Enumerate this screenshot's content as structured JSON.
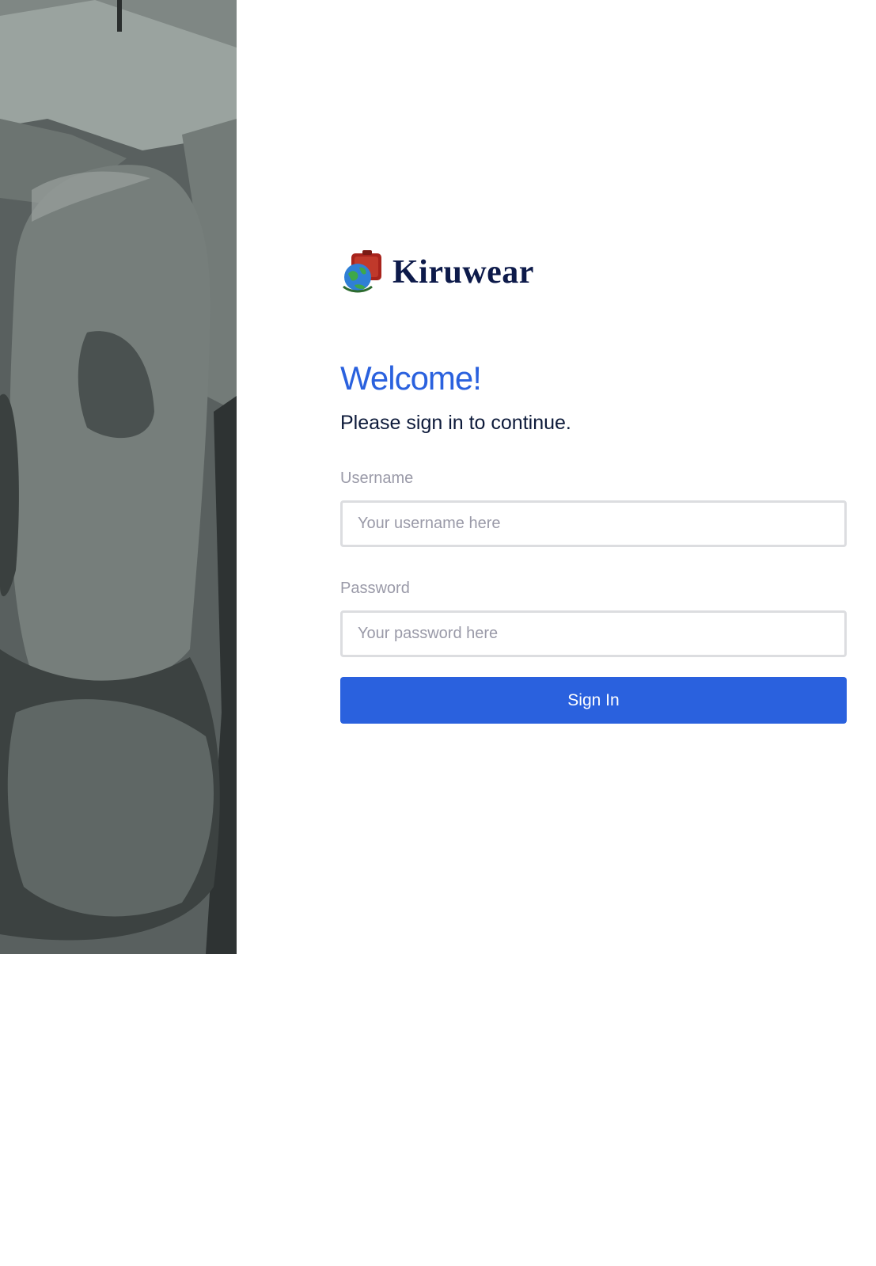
{
  "brand": {
    "name": "Kiruwear",
    "logo_icon": "globe-luggage-logo"
  },
  "side_image": {
    "description_icon": "stone-sculpture-photo"
  },
  "login": {
    "heading": "Welcome!",
    "subtitle": "Please sign in to continue.",
    "username": {
      "label": "Username",
      "placeholder": "Your username here",
      "value": ""
    },
    "password": {
      "label": "Password",
      "placeholder": "Your password here",
      "value": ""
    },
    "submit_label": "Sign In"
  },
  "colors": {
    "accent": "#2a61de",
    "heading_dark": "#0d1a3a",
    "label_gray": "#9a9aa8",
    "input_border": "#dcdde0"
  }
}
